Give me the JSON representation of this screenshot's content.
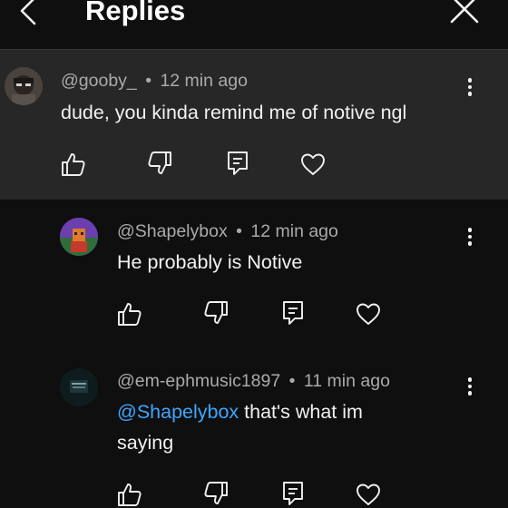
{
  "header": {
    "title": "Replies",
    "back_icon": "chevron-left-icon",
    "close_icon": "close-icon"
  },
  "comments": [
    {
      "author": "@gooby_",
      "time": "12 min ago",
      "text": "dude, you kinda remind me of notive ngl"
    },
    {
      "author": "@Shapelybox",
      "time": "12 min ago",
      "text": "He probably is Notive"
    },
    {
      "author": "@em-ephmusic1897",
      "time": "11 min ago",
      "mention": "@Shapelybox",
      "text": " that's what im saying"
    }
  ],
  "separator": "•",
  "actions": [
    "like-icon",
    "dislike-icon",
    "reply-icon",
    "heart-icon"
  ],
  "colors": {
    "background": "#0f0f0f",
    "highlight_bg": "#272727",
    "meta_text": "#aaaaaa",
    "mention": "#3ea6ff"
  }
}
